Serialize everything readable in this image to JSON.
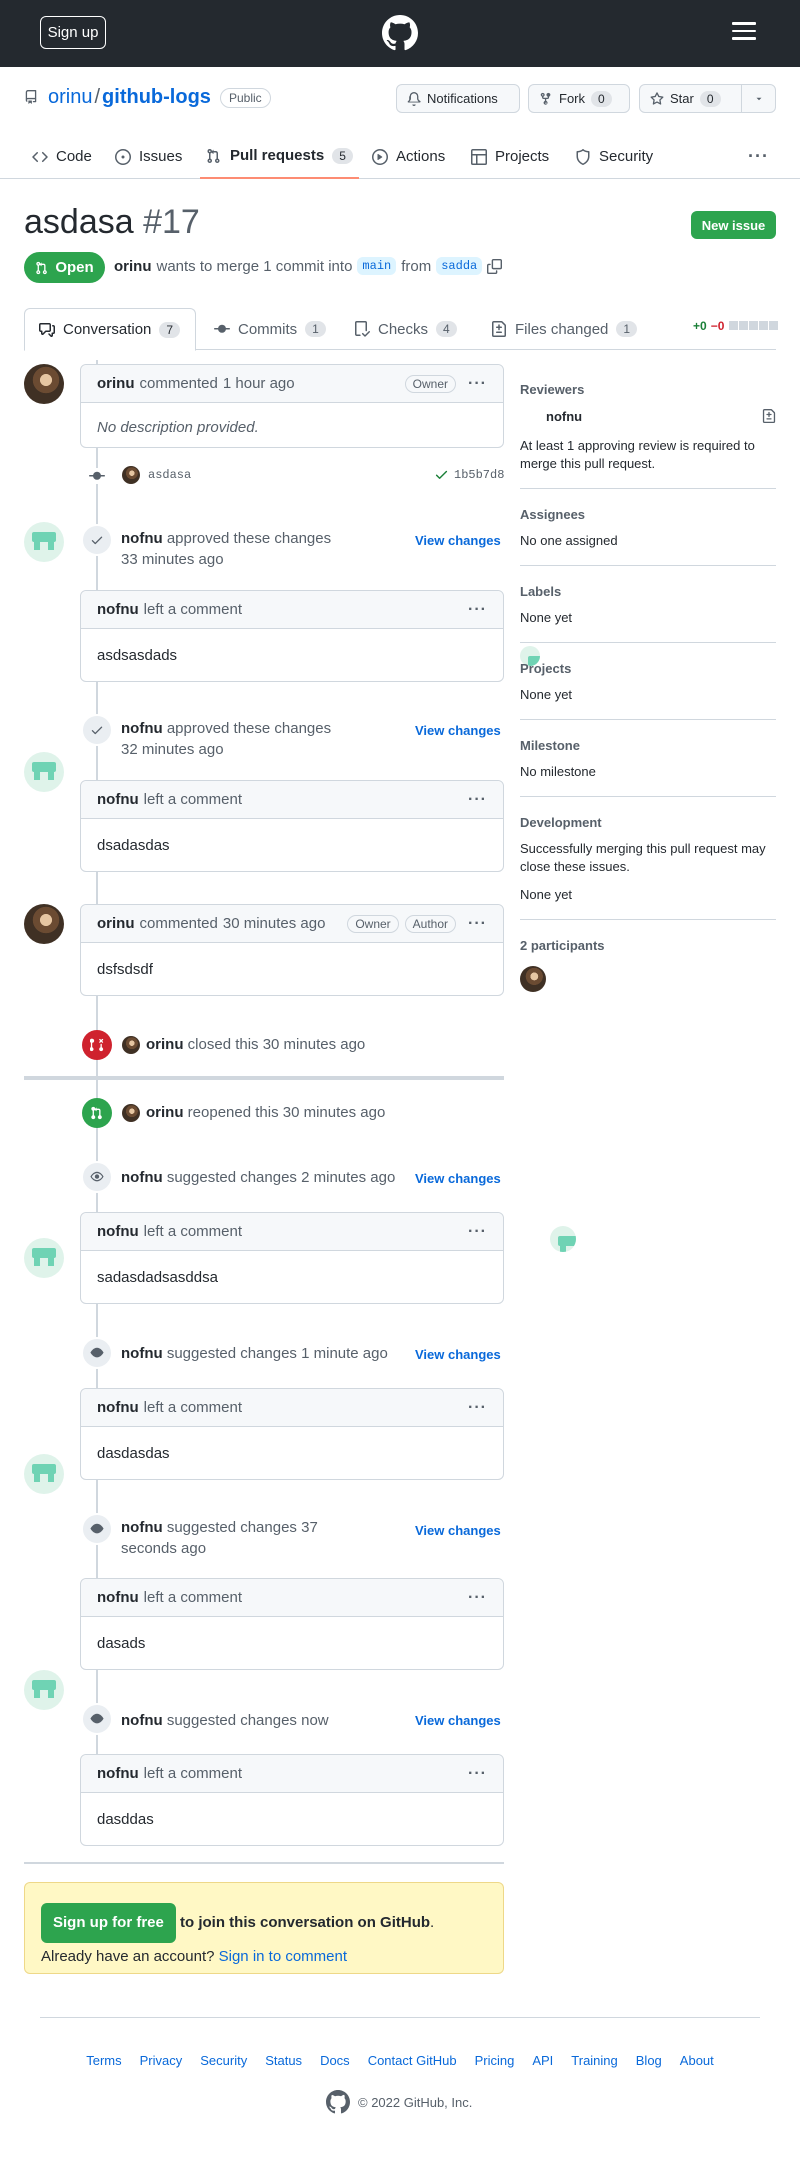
{
  "header": {
    "signup_label": "Sign up"
  },
  "repo": {
    "owner": "orinu",
    "sep": "/",
    "name": "github-logs",
    "visibility": "Public"
  },
  "repo_actions": {
    "notifications_label": "Notifications",
    "fork_label": "Fork",
    "fork_count": "0",
    "star_label": "Star",
    "star_count": "0"
  },
  "nav": {
    "code": "Code",
    "issues": "Issues",
    "pulls": "Pull requests",
    "pulls_count": "5",
    "actions": "Actions",
    "projects": "Projects",
    "security": "Security"
  },
  "pr": {
    "title": "asdasa",
    "number": "#17",
    "new_issue": "New issue",
    "state": "Open",
    "author": "orinu",
    "merge_text_1": "wants to merge 1 commit into",
    "base": "main",
    "merge_text_2": "from",
    "head": "sadda"
  },
  "tabs": {
    "conversation": "Conversation",
    "conversation_count": "7",
    "commits": "Commits",
    "commits_count": "1",
    "checks": "Checks",
    "checks_count": "4",
    "files": "Files changed",
    "files_count": "1",
    "additions": "+0",
    "deletions": "−0"
  },
  "timeline": {
    "first_comment": {
      "author": "orinu",
      "action": "commented",
      "time": "1 hour ago",
      "role": "Owner",
      "body": "No description provided."
    },
    "commit": {
      "message": "asdasa",
      "sha": "1b5b7d8"
    },
    "reviews": [
      {
        "author": "nofnu",
        "action": "approved these changes",
        "time": "33 minutes ago",
        "view": "View changes",
        "comment_author": "nofnu",
        "comment_action": "left a comment",
        "body": "asdsasdads"
      },
      {
        "author": "nofnu",
        "action": "approved these changes",
        "time": "32 minutes ago",
        "view": "View changes",
        "comment_author": "nofnu",
        "comment_action": "left a comment",
        "body": "dsadasdas"
      }
    ],
    "second_comment": {
      "author": "orinu",
      "action": "commented",
      "time": "30 minutes ago",
      "role1": "Owner",
      "role2": "Author",
      "body": "dsfsdsdf"
    },
    "closed": {
      "author": "orinu",
      "text": "closed this 30 minutes ago"
    },
    "reopened": {
      "author": "orinu",
      "text": "reopened this 30 minutes ago"
    },
    "suggestions": [
      {
        "author": "nofnu",
        "action": "suggested changes",
        "time": "2 minutes ago",
        "view": "View changes",
        "comment_author": "nofnu",
        "comment_action": "left a comment",
        "body": "sadasdadsasddsa"
      },
      {
        "author": "nofnu",
        "action": "suggested changes",
        "time": "1 minute ago",
        "view": "View changes",
        "comment_author": "nofnu",
        "comment_action": "left a comment",
        "body": "dasdasdas"
      },
      {
        "author": "nofnu",
        "action": "suggested changes",
        "time": "37 seconds ago",
        "view": "View changes",
        "comment_author": "nofnu",
        "comment_action": "left a comment",
        "body": "dasads"
      },
      {
        "author": "nofnu",
        "action": "suggested changes",
        "time": "now",
        "view": "View changes",
        "comment_author": "nofnu",
        "comment_action": "left a comment",
        "body": "dasddas"
      }
    ]
  },
  "join": {
    "button": "Sign up for free",
    "text_bold": "to join this conversation on GitHub",
    "text_2": ". Already have an account?",
    "signin": "Sign in to comment"
  },
  "sidebar": {
    "reviewers_label": "Reviewers",
    "reviewer": "nofnu",
    "reviewers_note": "At least 1 approving review is required to merge this pull request.",
    "assignees_label": "Assignees",
    "assignees_value": "No one assigned",
    "labels_label": "Labels",
    "labels_value": "None yet",
    "projects_label": "Projects",
    "projects_value": "None yet",
    "milestone_label": "Milestone",
    "milestone_value": "No milestone",
    "development_label": "Development",
    "development_note": "Successfully merging this pull request may close these issues.",
    "development_value": "None yet",
    "participants_label": "2 participants"
  },
  "footer": {
    "links": [
      "Terms",
      "Privacy",
      "Security",
      "Status",
      "Docs",
      "Contact GitHub",
      "Pricing",
      "API",
      "Training",
      "Blog",
      "About"
    ],
    "copyright": "© 2022 GitHub, Inc."
  }
}
